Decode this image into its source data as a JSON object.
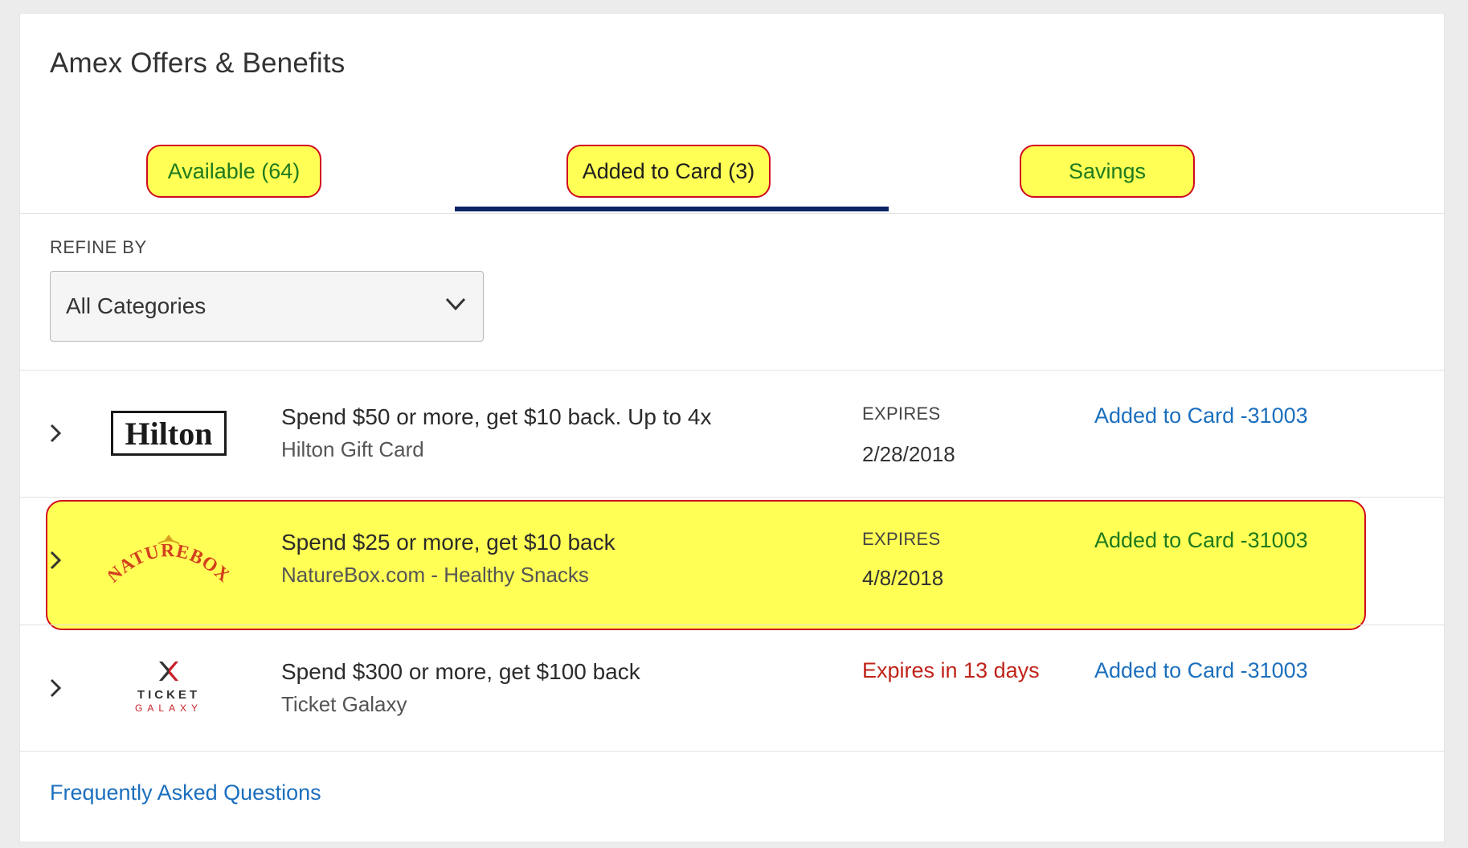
{
  "header": {
    "title": "Amex Offers & Benefits"
  },
  "tabs": [
    {
      "label": "Available (64)"
    },
    {
      "label": "Added to Card (3)"
    },
    {
      "label": "Savings"
    }
  ],
  "refine": {
    "label": "REFINE BY",
    "selected": "All Categories"
  },
  "offers": [
    {
      "logo_text": "Hilton",
      "headline": "Spend $50 or more, get $10 back. Up to 4x",
      "merchant": "Hilton Gift Card",
      "expires_label": "EXPIRES",
      "expires_date": "2/28/2018",
      "status": "Added to Card -31003"
    },
    {
      "logo_text": "NATUREBOX",
      "headline": "Spend $25 or more, get $10 back",
      "merchant": "NatureBox.com - Healthy Snacks",
      "expires_label": "EXPIRES",
      "expires_date": "4/8/2018",
      "status": "Added to Card -31003"
    },
    {
      "logo_text_top": "TICKET",
      "logo_text_bottom": "GALAXY",
      "headline": "Spend $300 or more, get $100 back",
      "merchant": "Ticket Galaxy",
      "expires_warning": "Expires in 13 days",
      "status": "Added to Card -31003"
    }
  ],
  "footer": {
    "faq_link": "Frequently Asked Questions"
  },
  "colors": {
    "highlight": "#ffff55",
    "highlight_border": "#d10a1f",
    "tab_underline": "#0b2465",
    "link": "#1b6fbd",
    "warning": "#c0231a",
    "green_text": "#1f7a1f"
  }
}
